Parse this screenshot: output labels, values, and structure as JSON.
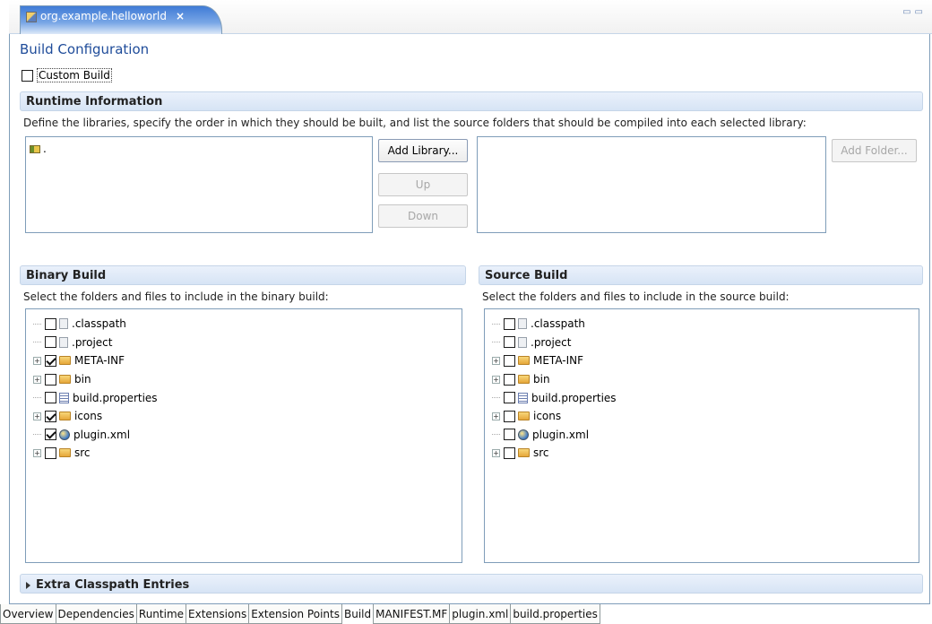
{
  "editor_tab": {
    "title": "org.example.helloworld",
    "close": "×"
  },
  "form_title": "Build Configuration",
  "custom_build_label": "Custom Build",
  "runtime": {
    "header": "Runtime Information",
    "description": "Define the libraries, specify the order in which they should be built, and list the source folders that should be compiled into each selected library:",
    "libraries": [
      "."
    ],
    "buttons": {
      "add_library": "Add Library...",
      "up": "Up",
      "down": "Down",
      "add_folder": "Add Folder..."
    }
  },
  "binary": {
    "header": "Binary Build",
    "description": "Select the folders and files to include in the binary build:",
    "items": [
      {
        "name": ".classpath",
        "kind": "file",
        "expandable": false,
        "checked": false
      },
      {
        "name": ".project",
        "kind": "file",
        "expandable": false,
        "checked": false
      },
      {
        "name": "META-INF",
        "kind": "folder",
        "expandable": true,
        "checked": true
      },
      {
        "name": "bin",
        "kind": "folder",
        "expandable": true,
        "checked": false
      },
      {
        "name": "build.properties",
        "kind": "properties",
        "expandable": false,
        "checked": false
      },
      {
        "name": "icons",
        "kind": "folder",
        "expandable": true,
        "checked": true
      },
      {
        "name": "plugin.xml",
        "kind": "xml",
        "expandable": false,
        "checked": true
      },
      {
        "name": "src",
        "kind": "folder",
        "expandable": true,
        "checked": false
      }
    ]
  },
  "source": {
    "header": "Source Build",
    "description": "Select the folders and files to include in the source build:",
    "items": [
      {
        "name": ".classpath",
        "kind": "file",
        "expandable": false,
        "checked": false
      },
      {
        "name": ".project",
        "kind": "file",
        "expandable": false,
        "checked": false
      },
      {
        "name": "META-INF",
        "kind": "folder",
        "expandable": true,
        "checked": false
      },
      {
        "name": "bin",
        "kind": "folder",
        "expandable": true,
        "checked": false
      },
      {
        "name": "build.properties",
        "kind": "properties",
        "expandable": false,
        "checked": false
      },
      {
        "name": "icons",
        "kind": "folder",
        "expandable": true,
        "checked": false
      },
      {
        "name": "plugin.xml",
        "kind": "xml",
        "expandable": false,
        "checked": false
      },
      {
        "name": "src",
        "kind": "folder",
        "expandable": true,
        "checked": false
      }
    ]
  },
  "extra_classpath_header": "Extra Classpath Entries",
  "bottom_tabs": [
    {
      "label": "Overview",
      "active": false
    },
    {
      "label": "Dependencies",
      "active": false
    },
    {
      "label": "Runtime",
      "active": false
    },
    {
      "label": "Extensions",
      "active": false
    },
    {
      "label": "Extension Points",
      "active": false
    },
    {
      "label": "Build",
      "active": true
    },
    {
      "label": "MANIFEST.MF",
      "active": false
    },
    {
      "label": "plugin.xml",
      "active": false
    },
    {
      "label": "build.properties",
      "active": false
    }
  ]
}
